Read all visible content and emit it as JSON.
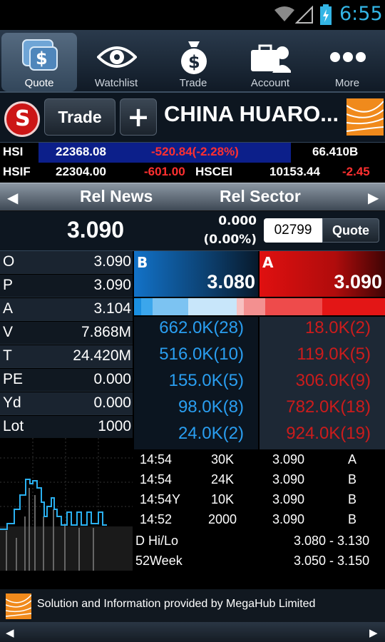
{
  "status_bar": {
    "time": "6:55"
  },
  "tabs": [
    {
      "label": "Quote",
      "icon": "quote-icon"
    },
    {
      "label": "Watchlist",
      "icon": "eye-icon"
    },
    {
      "label": "Trade",
      "icon": "money-bag-icon"
    },
    {
      "label": "Account",
      "icon": "briefcase-users-icon"
    },
    {
      "label": "More",
      "icon": "more-dots-icon"
    }
  ],
  "stock_header": {
    "trade_label": "Trade",
    "add_label": "+",
    "name": "CHINA HUARO...",
    "logo_letter": "S"
  },
  "indices": {
    "hsi": {
      "label": "HSI",
      "value": "22368.08",
      "change": "-520.84(-2.28%)",
      "turnover": "66.410B"
    },
    "hsif": {
      "label": "HSIF",
      "value": "22304.00",
      "change": "-601.00",
      "hscei_label": "HSCEI",
      "hscei_value": "10153.44",
      "hscei_change": "-2.45"
    }
  },
  "subnav": {
    "left": "Rel News",
    "right": "Rel Sector"
  },
  "price": {
    "last": "3.090",
    "change": "0.000",
    "change_pct": "(0.00%)",
    "code": "02799",
    "quote_label": "Quote"
  },
  "stats": [
    {
      "k": "O",
      "v": "3.090"
    },
    {
      "k": "P",
      "v": "3.090"
    },
    {
      "k": "A",
      "v": "3.104"
    },
    {
      "k": "V",
      "v": "7.868M"
    },
    {
      "k": "T",
      "v": "24.420M"
    },
    {
      "k": "PE",
      "v": "0.000"
    },
    {
      "k": "Yd",
      "v": "0.000"
    },
    {
      "k": "Lot",
      "v": "1000"
    }
  ],
  "bid": {
    "tag": "B",
    "price": "3.080"
  },
  "ask": {
    "tag": "A",
    "price": "3.090"
  },
  "depth": {
    "bids": [
      "662.0K(28)",
      "516.0K(10)",
      "155.0K(5)",
      "98.0K(8)",
      "24.0K(2)"
    ],
    "asks": [
      "18.0K(2)",
      "119.0K(5)",
      "306.0K(9)",
      "782.0K(18)",
      "924.0K(19)"
    ]
  },
  "trades": [
    {
      "time": "14:54",
      "qty": "30K",
      "price": "3.090",
      "side": "A"
    },
    {
      "time": "14:54",
      "qty": "24K",
      "price": "3.090",
      "side": "B"
    },
    {
      "time": "14:54Y",
      "qty": "10K",
      "price": "3.090",
      "side": "B"
    },
    {
      "time": "14:52",
      "qty": "2000",
      "price": "3.090",
      "side": "B"
    }
  ],
  "ranges": {
    "day_label": "D Hi/Lo",
    "day_value": "3.080 - 3.130",
    "week_label": "52Week",
    "week_value": "3.050 - 3.150"
  },
  "footer": {
    "credit": "Solution and Information provided by MegaHub Limited"
  },
  "colors": {
    "up": "#2a9ef0",
    "down": "#cc1c1c",
    "clock": "#33b5e5"
  }
}
